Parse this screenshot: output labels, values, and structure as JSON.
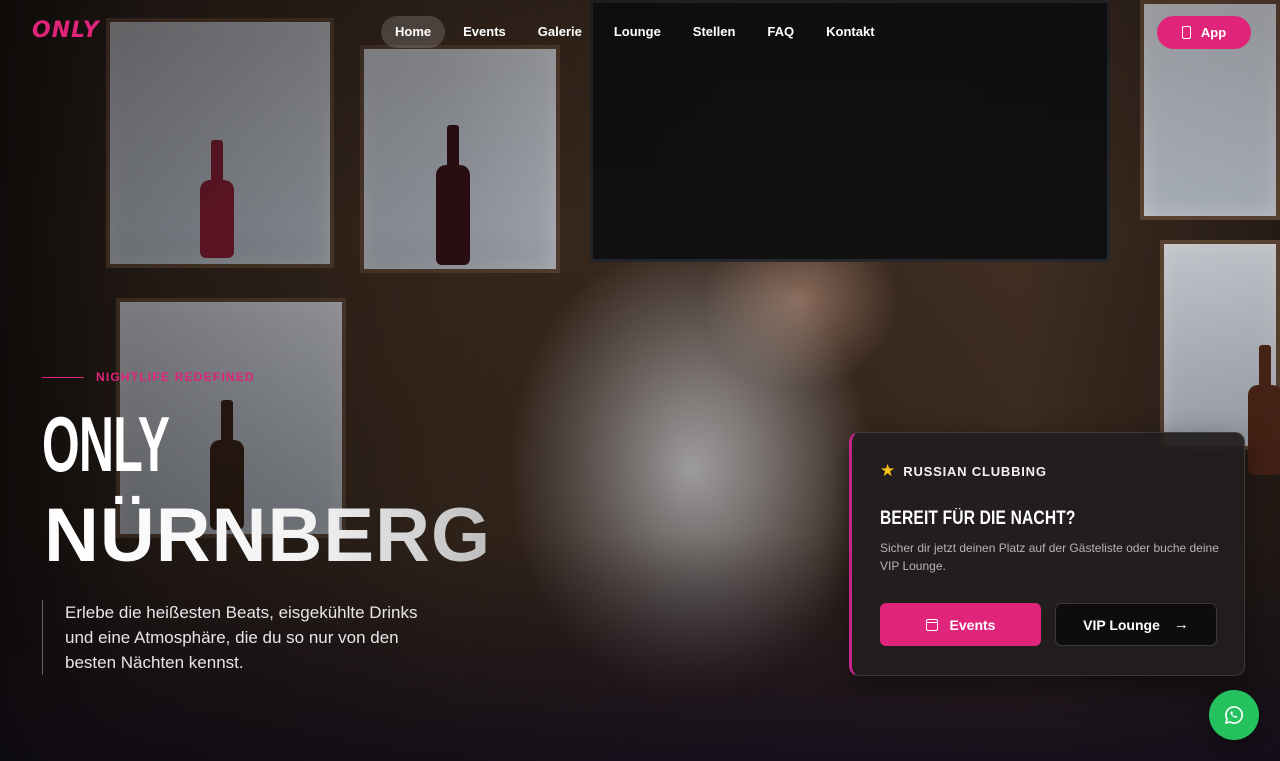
{
  "brand": {
    "logo_text": "ONLY",
    "color": "#e0247a"
  },
  "nav": {
    "items": [
      {
        "label": "Home",
        "active": true
      },
      {
        "label": "Events"
      },
      {
        "label": "Galerie"
      },
      {
        "label": "Lounge"
      },
      {
        "label": "Stellen"
      },
      {
        "label": "FAQ"
      },
      {
        "label": "Kontakt"
      }
    ],
    "app_button_label": "App"
  },
  "hero": {
    "tagline": "NIGHTLIFE REDEFINED",
    "title_line1": "ONLY",
    "title_line2": "NÜRNBERG",
    "lead": "Erlebe die heißesten Beats, eisgekühlte Drinks und eine Atmosphäre, die du so nur von den besten Nächten kennst."
  },
  "card": {
    "badge": "RUSSIAN CLUBBING",
    "title": "BEREIT FÜR DIE NACHT?",
    "text": "Sicher dir jetzt deinen Platz auf der Gästeliste oder buche deine VIP Lounge.",
    "primary_button": "Events",
    "secondary_button": "VIP Lounge"
  },
  "icons": {
    "app": "phone-icon",
    "badge": "star-icon",
    "events": "calendar-icon",
    "vip": "arrow-right-icon",
    "chat": "whatsapp-icon"
  },
  "colors": {
    "accent": "#e0247a",
    "star": "#f6c21c",
    "whatsapp": "#25c15f"
  }
}
